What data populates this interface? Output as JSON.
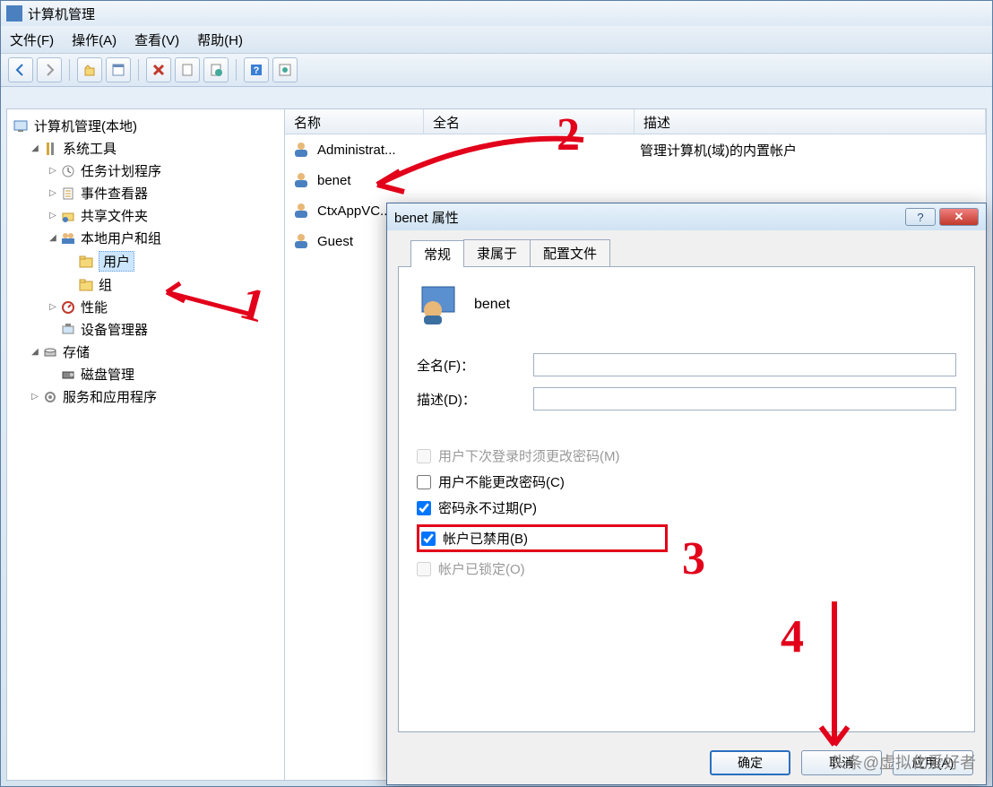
{
  "window": {
    "title": "计算机管理"
  },
  "menu": {
    "file": "文件(F)",
    "action": "操作(A)",
    "view": "查看(V)",
    "help": "帮助(H)"
  },
  "tree": {
    "root": "计算机管理(本地)",
    "system_tools": "系统工具",
    "task_scheduler": "任务计划程序",
    "event_viewer": "事件查看器",
    "shared_folders": "共享文件夹",
    "local_users_groups": "本地用户和组",
    "users": "用户",
    "groups": "组",
    "performance": "性能",
    "device_manager": "设备管理器",
    "storage": "存储",
    "disk_management": "磁盘管理",
    "services_apps": "服务和应用程序"
  },
  "list": {
    "cols": {
      "name": "名称",
      "fullname": "全名",
      "description": "描述"
    },
    "rows": [
      {
        "name": "Administrat...",
        "desc": "管理计算机(域)的内置帐户"
      },
      {
        "name": "benet",
        "desc": ""
      },
      {
        "name": "CtxAppVC...",
        "desc": ""
      },
      {
        "name": "Guest",
        "desc": ""
      }
    ]
  },
  "dialog": {
    "title": "benet 属性",
    "tabs": {
      "general": "常规",
      "member_of": "隶属于",
      "profile": "配置文件"
    },
    "username": "benet",
    "labels": {
      "fullname": "全名(F)：",
      "description": "描述(D)：",
      "must_change": "用户下次登录时须更改密码(M)",
      "cannot_change": "用户不能更改密码(C)",
      "never_expire": "密码永不过期(P)",
      "disabled": "帐户已禁用(B)",
      "locked": "帐户已锁定(O)"
    },
    "checks": {
      "must_change": false,
      "cannot_change": false,
      "never_expire": true,
      "disabled": true,
      "locked": false
    },
    "buttons": {
      "ok": "确定",
      "cancel": "取消",
      "apply": "应用(A)"
    }
  },
  "annotations": {
    "n1": "1",
    "n2": "2",
    "n3": "3",
    "n4": "4"
  },
  "watermark": "头条@虚拟化爱好者"
}
